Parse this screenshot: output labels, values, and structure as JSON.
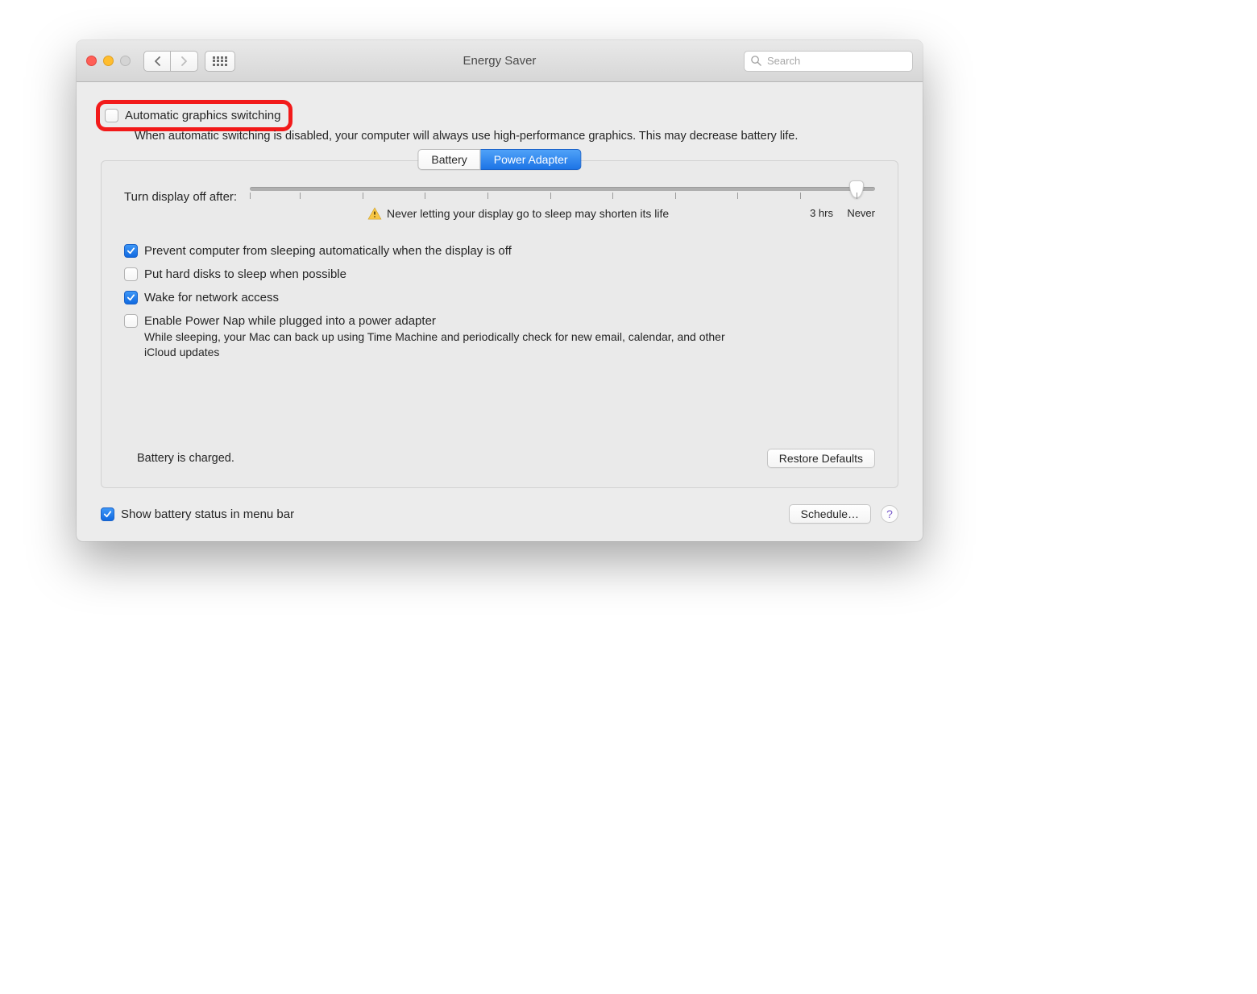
{
  "window": {
    "title": "Energy Saver"
  },
  "search": {
    "placeholder": "Search"
  },
  "auto_switching": {
    "label": "Automatic graphics switching",
    "sub": "When automatic switching is disabled, your computer will always use high-performance graphics. This may decrease battery life.",
    "checked": false
  },
  "tabs": {
    "battery": "Battery",
    "power_adapter": "Power Adapter",
    "active": "power_adapter"
  },
  "slider": {
    "label": "Turn display off after:",
    "warning": "Never letting your display go to sleep may shorten its life",
    "end_labels": {
      "three_hours": "3 hrs",
      "never": "Never"
    },
    "value_position_pct": 97
  },
  "options": {
    "prevent_sleep": {
      "label": "Prevent computer from sleeping automatically when the display is off",
      "checked": true
    },
    "hdd_sleep": {
      "label": "Put hard disks to sleep when possible",
      "checked": false
    },
    "wake_network": {
      "label": "Wake for network access",
      "checked": true
    },
    "power_nap": {
      "label": "Enable Power Nap while plugged into a power adapter",
      "sub": "While sleeping, your Mac can back up using Time Machine and periodically check for new email, calendar, and other iCloud updates",
      "checked": false
    }
  },
  "status": "Battery is charged.",
  "buttons": {
    "restore": "Restore Defaults",
    "schedule": "Schedule…"
  },
  "menubar": {
    "label": "Show battery status in menu bar",
    "checked": true
  },
  "help": "?"
}
